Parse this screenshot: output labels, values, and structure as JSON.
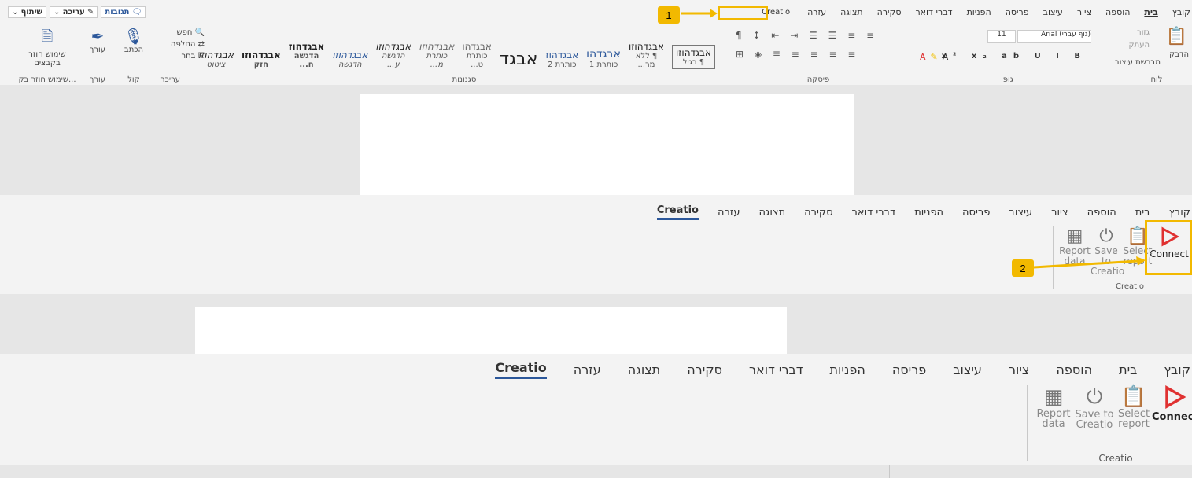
{
  "ribbon_tabs": [
    "קובץ",
    "בית",
    "הוספה",
    "ציור",
    "עיצוב",
    "פריסה",
    "הפניות",
    "דברי דואר",
    "סקירה",
    "תצוגה",
    "עזרה",
    "Creatio"
  ],
  "panel1": {
    "top_buttons": {
      "share": "שיתוף",
      "edit": "עריכה",
      "comments": "תגובות"
    },
    "clipboard": {
      "paste": "הדבק",
      "cut": "גזור",
      "copy": "העתק",
      "format_painter": "מברשת עיצוב",
      "group": "לוח"
    },
    "font": {
      "name": "(גוף עברי) Arial",
      "size": "11",
      "group": "גופן"
    },
    "paragraph": {
      "group": "פיסקה"
    },
    "styles": {
      "group": "סגנונות",
      "items": [
        {
          "preview": "אבגדהוזו",
          "name": "¶ רגיל"
        },
        {
          "preview": "אבגדהוזו",
          "name": "¶ ללא מר..."
        },
        {
          "preview": "אבגדהו",
          "name": "כותרת 1"
        },
        {
          "preview": "אבגדהוז",
          "name": "כותרת 2"
        },
        {
          "preview": "אבגד",
          "name": ""
        },
        {
          "preview": "אבגדהו",
          "name": "כותרת ט..."
        },
        {
          "preview": "אבגדהוזו",
          "name": "כותרת מ..."
        },
        {
          "preview": "אבגדהוזו",
          "name": "הדגשה ע..."
        },
        {
          "preview": "אבגדהוזו",
          "name": "הדגשה"
        },
        {
          "preview": "אבגדהוז",
          "name": "הדגשה ח..."
        },
        {
          "preview": "אבגדהוזו",
          "name": "חזק"
        },
        {
          "preview": "אבגדהוזו",
          "name": "ציטוט"
        }
      ]
    },
    "editing": {
      "find": "חפש",
      "replace": "החלפה",
      "select": "בחר",
      "group": "עריכה"
    },
    "voice": {
      "dictate": "הכתב",
      "group": "קול"
    },
    "editor": {
      "label": "עורך",
      "group": "עורך"
    },
    "reuse": {
      "label": "שימוש חוזר בקבצים",
      "group": "שימוש חוזר בק..."
    }
  },
  "creatio": {
    "group_title": "Creatio",
    "buttons": [
      {
        "id": "connect",
        "label": "Connect"
      },
      {
        "id": "select_report",
        "line1": "Select",
        "line2": "report"
      },
      {
        "id": "save_to_creatio",
        "line1": "Save to",
        "line2": "Creatio"
      },
      {
        "id": "report_data",
        "line1": "Report",
        "line2": "data"
      }
    ]
  },
  "callouts": [
    "1",
    "2"
  ],
  "colors": {
    "accent_yellow": "#f2b900",
    "connect_red": "#e03131",
    "tab_underline": "#2b579a"
  }
}
